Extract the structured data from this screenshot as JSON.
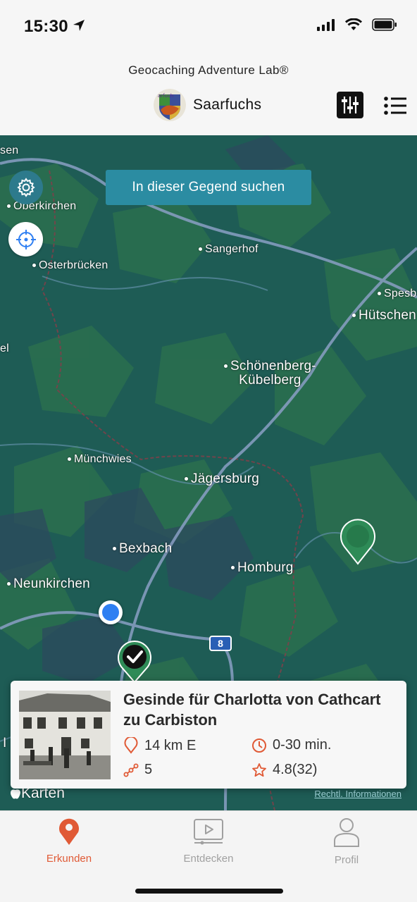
{
  "status": {
    "time": "15:30"
  },
  "header": {
    "app_title": "Geocaching Adventure Lab®",
    "brand_name": "Saarfuchs"
  },
  "map": {
    "search_area_button": "In dieser Gegend suchen",
    "places": {
      "oberkirchen": "Oberkirchen",
      "osterbruecken": "Osterbrücken",
      "sangerhof": "Sangerhof",
      "spesbach": "Spesb",
      "huetschen": "Hütschen",
      "schoenenberg": "Schönenberg-\nKübelberg",
      "muenchwies": "Münchwies",
      "jaegersburg": "Jägersburg",
      "bexbach": "Bexbach",
      "homburg": "Homburg",
      "neunkirchen": "Neunkirchen",
      "sen": "sen",
      "el": "el",
      "l": "I"
    },
    "highway_number": "8",
    "credit": "Karten",
    "legal_link": "Rechtl. Informationen"
  },
  "card": {
    "title": "Gesinde für Charlotta von Cathcart zu Carbiston",
    "distance": "14 km E",
    "duration": "0-30 min.",
    "stages": "5",
    "rating": "4.8(32)"
  },
  "tabs": [
    {
      "label": "Erkunden",
      "active": true
    },
    {
      "label": "Entdecken",
      "active": false
    },
    {
      "label": "Profil",
      "active": false
    }
  ],
  "colors": {
    "accent": "#e05a36",
    "map_bg": "#1f5f55",
    "pin_green": "#2e8b57",
    "search_button": "#2b8ca2"
  }
}
